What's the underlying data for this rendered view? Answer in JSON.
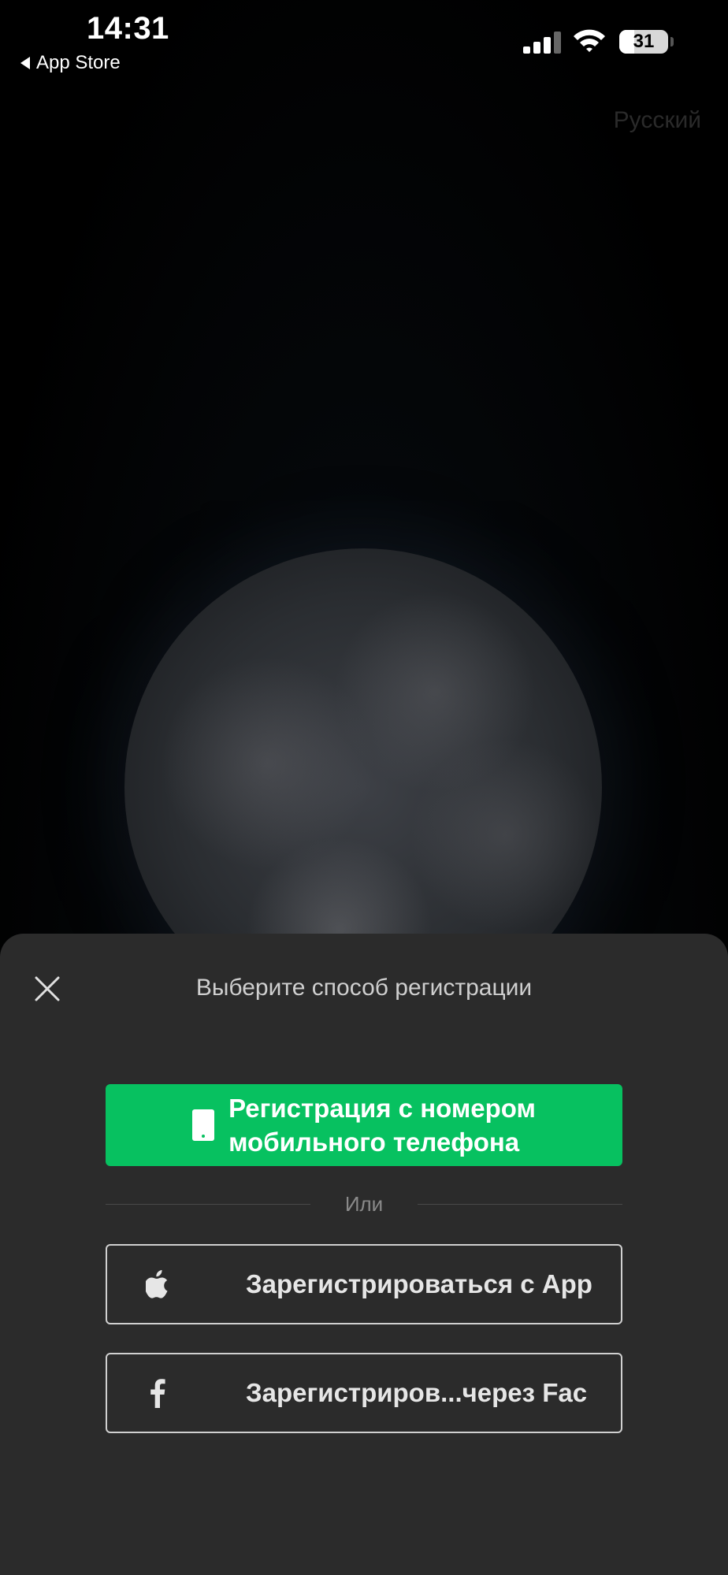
{
  "status_bar": {
    "time": "14:31",
    "back_label": "App Store",
    "battery": "31"
  },
  "language_label": "Русский",
  "sheet": {
    "title": "Выберите способ регистрации",
    "phone_button": {
      "line1": "Регистрация с номером",
      "line2": "мобильного телефона",
      "icon": "phone-icon"
    },
    "or_text": "Или",
    "apple_button": {
      "label": "Зарегистрироваться с App",
      "icon": "apple-icon"
    },
    "facebook_button": {
      "label": "Зарегистриров...через Fac",
      "icon": "facebook-icon"
    }
  },
  "colors": {
    "accent_green": "#07c160",
    "sheet_background": "#2b2b2b"
  }
}
